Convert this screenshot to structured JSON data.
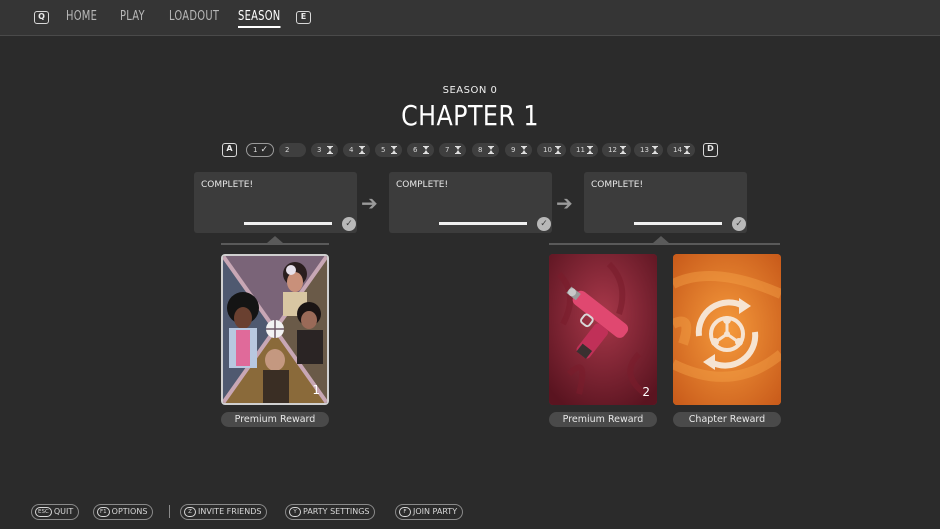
{
  "nav": {
    "prev_key": "Q",
    "next_key": "E",
    "items": [
      {
        "label": "HOME",
        "active": false
      },
      {
        "label": "PLAY",
        "active": false
      },
      {
        "label": "LOADOUT",
        "active": false
      },
      {
        "label": "SEASON",
        "active": true
      }
    ]
  },
  "season": {
    "season_label": "SEASON 0",
    "chapter_title": "CHAPTER 1"
  },
  "stages": {
    "prev_key": "A",
    "next_key": "D",
    "items": [
      {
        "label": "1",
        "state": "completed-current"
      },
      {
        "label": "2",
        "state": "available"
      },
      {
        "label": "3",
        "state": "locked"
      },
      {
        "label": "4",
        "state": "locked"
      },
      {
        "label": "5",
        "state": "locked"
      },
      {
        "label": "6",
        "state": "locked"
      },
      {
        "label": "7",
        "state": "locked"
      },
      {
        "label": "8",
        "state": "locked"
      },
      {
        "label": "9",
        "state": "locked"
      },
      {
        "label": "10",
        "state": "locked"
      },
      {
        "label": "11",
        "state": "locked"
      },
      {
        "label": "12",
        "state": "locked"
      },
      {
        "label": "13",
        "state": "locked"
      },
      {
        "label": "14",
        "state": "locked"
      }
    ]
  },
  "progress": [
    {
      "label": "COMPLETE!",
      "fraction": 1.0
    },
    {
      "label": "COMPLETE!",
      "fraction": 1.0
    },
    {
      "label": "COMPLETE!",
      "fraction": 1.0
    }
  ],
  "rewards": [
    {
      "label": "Premium Reward",
      "quantity": "1",
      "art": "characters-bundle"
    },
    {
      "label": "Premium Reward",
      "quantity": "2",
      "art": "pink-pistol"
    },
    {
      "label": "Chapter Reward",
      "quantity": "",
      "art": "chapter-emblem"
    }
  ],
  "footer": [
    {
      "key": "ESC",
      "label": "QUIT"
    },
    {
      "key": "F1",
      "label": "OPTIONS"
    },
    {
      "key": "Z",
      "label": "INVITE FRIENDS"
    },
    {
      "key": "Y",
      "label": "PARTY SETTINGS"
    },
    {
      "key": "F",
      "label": "JOIN PARTY"
    }
  ],
  "colors": {
    "background": "#2b2b2b",
    "topbar": "#353535",
    "card": "#3c3c3c",
    "chapter_reward_orange": "#e8752a",
    "pistol_red": "#9a2638"
  }
}
